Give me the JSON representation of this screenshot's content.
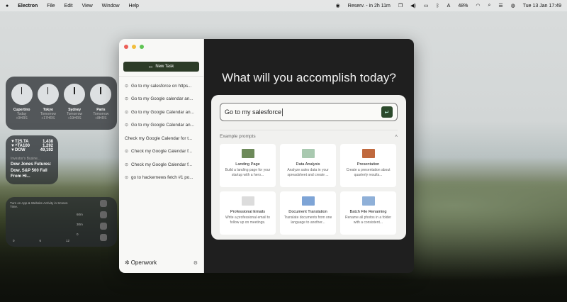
{
  "menubar": {
    "app": "Electron",
    "menus": [
      "File",
      "Edit",
      "View",
      "Window",
      "Help"
    ],
    "reminder": "Reserv. - in 2h 11m",
    "battery": "48%",
    "datetime": "Tue 13 Jan  17:49"
  },
  "clocks": [
    {
      "city": "Cupertino",
      "day": "Today",
      "offset": "+0HRS"
    },
    {
      "city": "Tokyo",
      "day": "Tomorrow",
      "offset": "+17HRS"
    },
    {
      "city": "Sydney",
      "day": "Tomorrow",
      "offset": "+19HRS"
    },
    {
      "city": "Paris",
      "day": "Tomorrow",
      "offset": "+8HRS"
    }
  ],
  "stocks": {
    "rows": [
      {
        "symbol": "▼T25.TA",
        "value": "1,438"
      },
      {
        "symbol": "▼^TA100",
        "value": "1,292"
      },
      {
        "symbol": "▼DOW",
        "value": "49,192"
      }
    ],
    "source": "Investor's Busine...",
    "headline": "Dow Jones Futures: Dow, S&P 500 Fall From Hi..."
  },
  "screen_time": {
    "text": "Turn on App & Website Activity in Screen Time.",
    "y_labels": [
      "60m",
      "30m",
      "0"
    ],
    "x_labels": [
      "0",
      "6",
      "12"
    ]
  },
  "sidebar": {
    "new_task": "New Task",
    "tasks": [
      "Go to my salesforce on https...",
      "Go to my Google calendar an...",
      "Go to my Google Calendar an...",
      "Go to my Google Calendar an...",
      "Check my Google Calendar for t...",
      "Check my Google Calendar f...",
      "Check my Google Calendar f...",
      "go to hackernews fetch #1 po..."
    ],
    "brand": "Openwork"
  },
  "main": {
    "headline": "What will you accomplish today?",
    "input_value": "Go to my salesforce",
    "examples_label": "Example prompts",
    "examples": [
      {
        "title": "Landing Page",
        "desc": "Build a landing page for your startup with a hero...",
        "color": "#6d8a5a"
      },
      {
        "title": "Data Analysis",
        "desc": "Analyze sales data in your spreadsheet and create ...",
        "color": "#a9c9b0"
      },
      {
        "title": "Presentation",
        "desc": "Create a presentation about quarterly results...",
        "color": "#c0693e"
      },
      {
        "title": "Professional Emails",
        "desc": "Write a professional email to follow up on meetings.",
        "color": "#dcdcdc"
      },
      {
        "title": "Document Translation",
        "desc": "Translate documents from one language to another...",
        "color": "#7ea4d6"
      },
      {
        "title": "Batch File Renaming",
        "desc": "Rename all photos in a folder with a consistent...",
        "color": "#8fb0d8"
      }
    ]
  },
  "colors": {
    "accent": "#2c3b27",
    "main_bg": "#1f1f1f"
  }
}
